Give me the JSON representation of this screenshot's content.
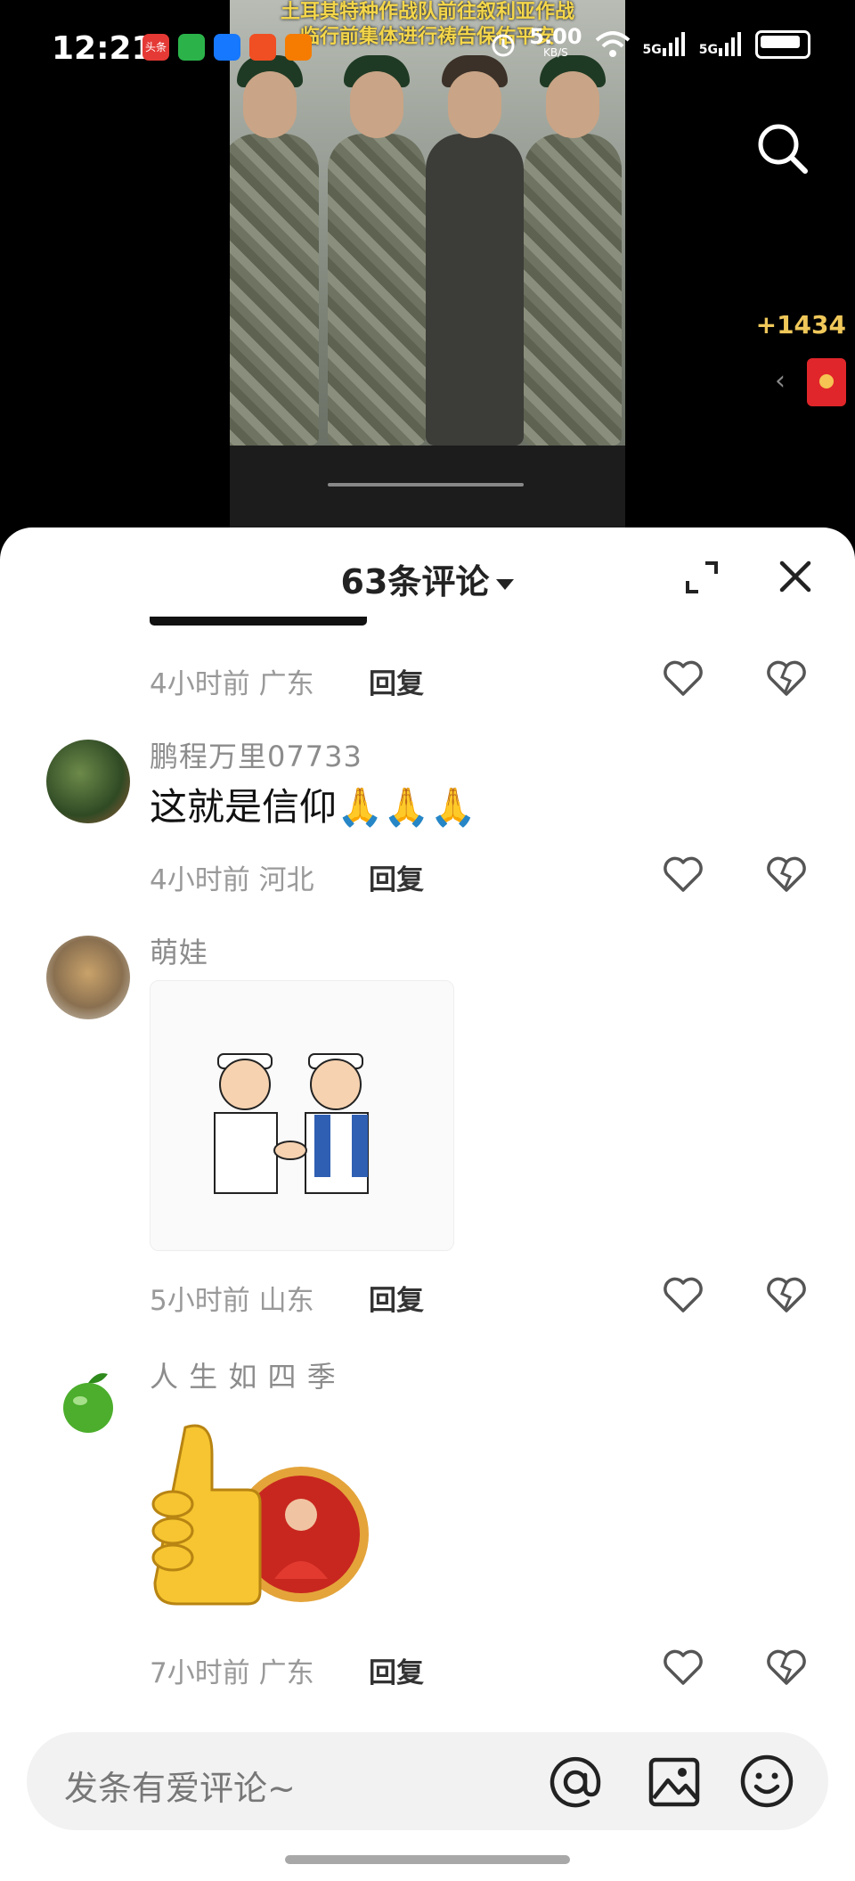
{
  "status_bar": {
    "time": "12:21",
    "speed": "5.00",
    "speed_unit": "KB/S",
    "signal1": "5G",
    "signal2": "5G",
    "app_icons": [
      "头条"
    ]
  },
  "video": {
    "caption_line1": "土耳其特种作战队前往叙利亚作战",
    "caption_line2": "临行前集体进行祷告保佑平安"
  },
  "side": {
    "count": "+1434"
  },
  "comments_panel": {
    "title": "63条评论",
    "comments": [
      {
        "time": "4小时前",
        "location": "广东",
        "reply": "回复"
      },
      {
        "username": "鹏程万里07733",
        "text": "这就是信仰🙏🙏🙏",
        "time": "4小时前",
        "location": "河北",
        "reply": "回复"
      },
      {
        "username": "萌娃",
        "time": "5小时前",
        "location": "山东",
        "reply": "回复"
      },
      {
        "username": "人 生 如 四 季",
        "time": "7小时前",
        "location": "广东",
        "reply": "回复"
      }
    ]
  },
  "input": {
    "placeholder": "发条有爱评论~"
  },
  "colors": {
    "accent_yellow": "#f0c85a",
    "red_packet": "#e0262a",
    "meta_gray": "#999999"
  },
  "icons": [
    "search-icon",
    "expand-icon",
    "close-icon",
    "heart-icon",
    "broken-heart-icon",
    "at-icon",
    "image-icon",
    "emoji-icon",
    "caret-down-icon",
    "chevron-left-icon"
  ]
}
